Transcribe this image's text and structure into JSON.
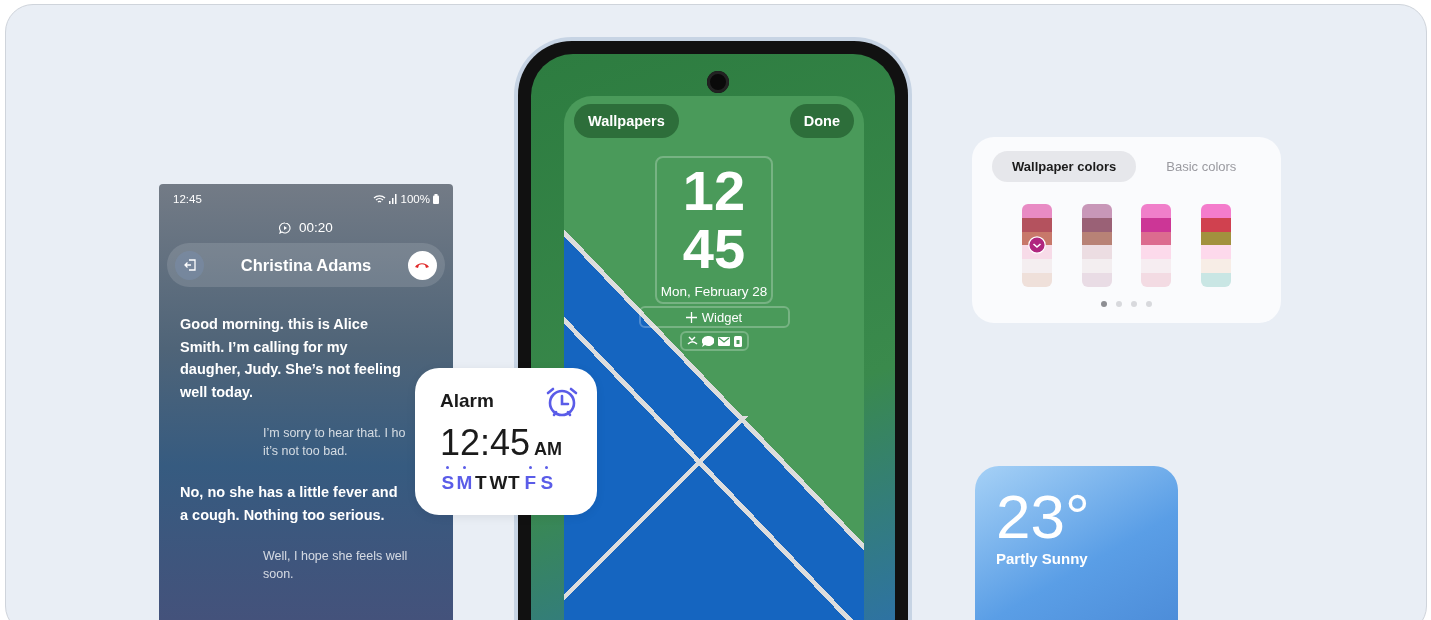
{
  "call": {
    "status_time": "12:45",
    "battery": "100%",
    "duration": "00:20",
    "caller": "Christina Adams",
    "messages": [
      {
        "kind": "caller",
        "lines": [
          "Good morning. this is Alice",
          "Smith. I’m calling for my",
          "daugher, Judy. She’s not feeling",
          "well today."
        ]
      },
      {
        "kind": "reply",
        "lines": [
          "I’m sorry to hear that. I ho",
          "it’s not too bad."
        ]
      },
      {
        "kind": "caller",
        "lines": [
          "No, no she has a little fever and",
          "a cough. Nothing too serious."
        ]
      },
      {
        "kind": "reply",
        "lines": [
          "Well, I hope she feels well",
          "soon."
        ]
      }
    ]
  },
  "alarm": {
    "title": "Alarm",
    "time": "12:45",
    "period": "AM",
    "days": [
      {
        "label": "S",
        "selected": true
      },
      {
        "label": "M",
        "selected": true
      },
      {
        "label": "T",
        "selected": false
      },
      {
        "label": "W",
        "selected": false
      },
      {
        "label": "T",
        "selected": false
      },
      {
        "label": "F",
        "selected": true
      },
      {
        "label": "S",
        "selected": true
      }
    ]
  },
  "lock_screen": {
    "wallpapers_button": "Wallpapers",
    "done_button": "Done",
    "hour": "12",
    "minute": "45",
    "date": "Mon, February 28",
    "widget_button": "Widget"
  },
  "palette": {
    "tabs": [
      {
        "label": "Wallpaper colors",
        "selected": true
      },
      {
        "label": "Basic colors",
        "selected": false
      }
    ],
    "palettes": [
      {
        "selected": true,
        "swatches": [
          {
            "color": "#e88bc4"
          },
          {
            "color": "#b4525e"
          },
          {
            "color": "#c8786a"
          },
          {
            "color": "#f7dbe8"
          },
          {
            "color": "#f4eef0"
          },
          {
            "color": "#efe0da"
          }
        ]
      },
      {
        "selected": false,
        "swatches": [
          {
            "color": "#c897b8"
          },
          {
            "color": "#9a6176"
          },
          {
            "color": "#b88276"
          },
          {
            "color": "#ecdde2"
          },
          {
            "color": "#f3eef0"
          },
          {
            "color": "#e9dce5"
          }
        ]
      },
      {
        "selected": false,
        "swatches": [
          {
            "color": "#f07fca"
          },
          {
            "color": "#cc3696"
          },
          {
            "color": "#dc6b8f"
          },
          {
            "color": "#fcdaeb"
          },
          {
            "color": "#f6edf1"
          },
          {
            "color": "#f3dbe3"
          }
        ]
      },
      {
        "selected": false,
        "swatches": [
          {
            "color": "#f47ccc"
          },
          {
            "color": "#d0414f"
          },
          {
            "color": "#a2913e"
          },
          {
            "color": "#fdd9ec"
          },
          {
            "color": "#f7ede6"
          },
          {
            "color": "#c9e6e4"
          }
        ]
      }
    ],
    "pages": [
      {
        "selected": true
      },
      {
        "selected": false
      },
      {
        "selected": false
      },
      {
        "selected": false
      }
    ]
  },
  "weather": {
    "temperature": "23°",
    "condition": "Partly Sunny"
  }
}
